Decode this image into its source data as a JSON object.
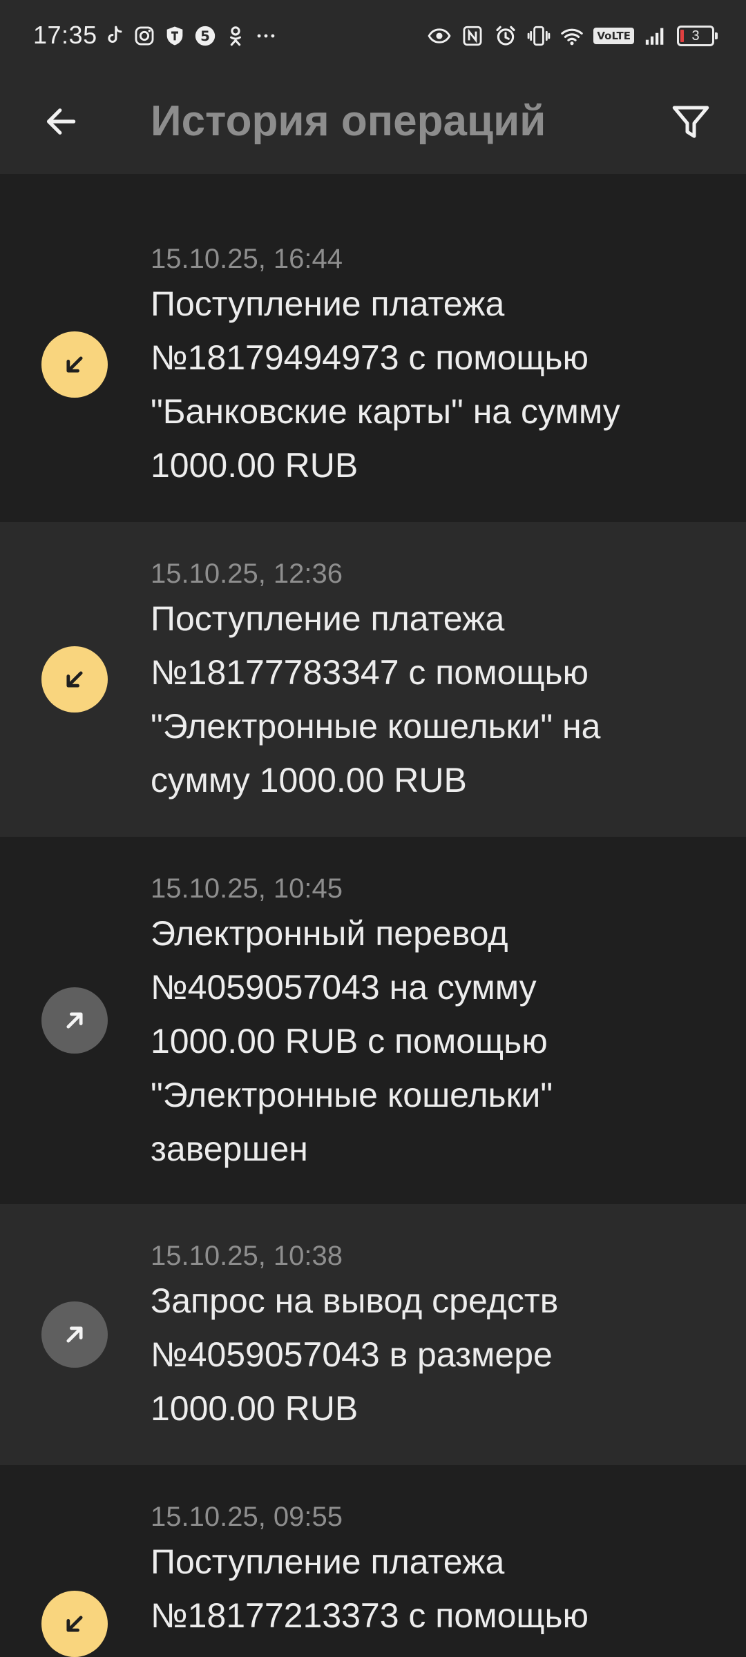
{
  "status_bar": {
    "time": "17:35",
    "battery_level": "3",
    "network_badge": "VoLTE",
    "left_icons": [
      "tiktok-icon",
      "instagram-icon",
      "shield-app-icon",
      "five-channel-icon",
      "ok-icon",
      "more-dots-icon"
    ],
    "right_icons": [
      "eye-icon",
      "nfc-icon",
      "alarm-icon",
      "vibrate-icon",
      "wifi-icon",
      "volte-icon",
      "signal-icon",
      "battery-icon"
    ]
  },
  "header": {
    "title": "История операций",
    "back_icon": "arrow-left-icon",
    "filter_icon": "filter-icon"
  },
  "colors": {
    "incoming_badge": "#f9d57e",
    "outgoing_badge": "#5f5f5f",
    "row_dark": "#1f1f1f",
    "row_light": "#2b2b2b",
    "title_gray": "#8d8d8d"
  },
  "operations": [
    {
      "date": "15.10.25, 16:44",
      "text": "Поступление платежа\n№18179494973 с помощью\n\"Банковские карты\" на сумму\n1000.00 RUB",
      "direction": "incoming",
      "icon": "arrow-down-left-icon"
    },
    {
      "date": "15.10.25, 12:36",
      "text": "Поступление платежа\n№18177783347 с помощью\n\"Электронные кошельки\" на\nсумму 1000.00 RUB",
      "direction": "incoming",
      "icon": "arrow-down-left-icon"
    },
    {
      "date": "15.10.25, 10:45",
      "text": "Электронный перевод\n№4059057043 на сумму\n1000.00 RUB с помощью\n\"Электронные кошельки\"\nзавершен",
      "direction": "outgoing",
      "icon": "arrow-up-right-icon"
    },
    {
      "date": "15.10.25, 10:38",
      "text": "Запрос на вывод средств\n№4059057043 в размере\n1000.00 RUB",
      "direction": "outgoing",
      "icon": "arrow-up-right-icon"
    },
    {
      "date": "15.10.25, 09:55",
      "text": "Поступление платежа\n№18177213373 с помощью",
      "direction": "incoming",
      "icon": "arrow-down-left-icon"
    }
  ]
}
